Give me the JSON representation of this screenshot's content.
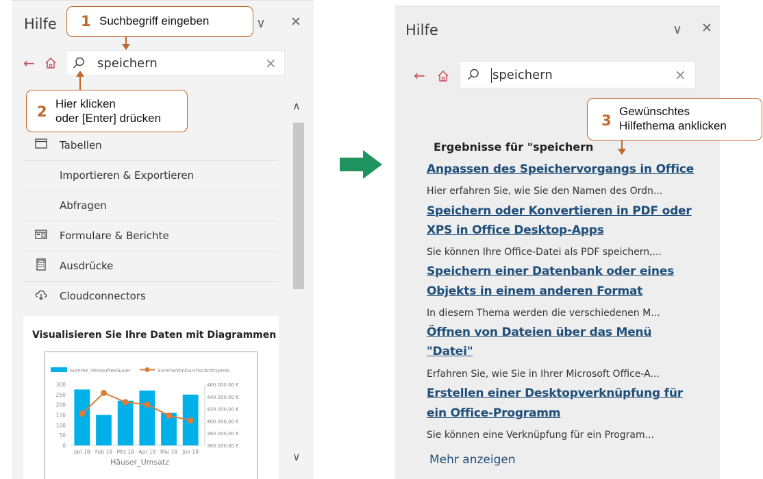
{
  "left_panel": {
    "title": "Hilfe",
    "search_value": "speichern",
    "categories": [
      {
        "label": "Tabellen",
        "icon": "table-icon"
      },
      {
        "label": "Importieren & Exportieren",
        "icon": ""
      },
      {
        "label": "Abfragen",
        "icon": ""
      },
      {
        "label": "Formulare & Berichte",
        "icon": "form-icon"
      },
      {
        "label": "Ausdrücke",
        "icon": "calculator-icon"
      },
      {
        "label": "Cloudconnectors",
        "icon": "cloud-icon"
      }
    ],
    "card": {
      "title": "Visualisieren Sie Ihre Daten mit Diagrammen"
    }
  },
  "chart_data": {
    "type": "bar",
    "title": "",
    "xlabel": "Häuser_Umsatz",
    "categories": [
      "Jan 18",
      "Feb 18",
      "Mrz 18",
      "Apr 18",
      "Mai 18",
      "Jun 18"
    ],
    "series": [
      {
        "name": "Summe_VerkaufteHäuser",
        "type": "bar",
        "axis": "left",
        "values": [
          275,
          150,
          220,
          270,
          160,
          250
        ]
      },
      {
        "name": "SummeVonDurchschnittspreis",
        "type": "line",
        "axis": "right",
        "values": [
          412000,
          446000,
          431000,
          427000,
          409000,
          401000
        ]
      }
    ],
    "y_left": {
      "ylim": [
        0,
        300
      ],
      "ticks": [
        "0",
        "50",
        "100",
        "150",
        "200",
        "250",
        "300"
      ]
    },
    "y_right": {
      "ylim": [
        360000,
        460000
      ],
      "ticks": [
        "360.000,00 €",
        "380.000,00 €",
        "400.000,00 €",
        "420.000,00 €",
        "440.000,00 €",
        "460.000,00 €"
      ]
    },
    "colors": {
      "bar": "#00b0e8",
      "line": "#e07b39"
    }
  },
  "right_panel": {
    "title": "Hilfe",
    "search_value": "speichern",
    "results_heading": "Ergebnisse für \"speichern",
    "results": [
      {
        "link_lines": [
          "Anpassen des Speichervorgangs in Office"
        ],
        "desc": "Hier erfahren Sie, wie Sie den Namen des Ordn..."
      },
      {
        "link_lines": [
          "Speichern oder Konvertieren in PDF oder",
          "XPS in Office Desktop-Apps"
        ],
        "desc": "Sie können Ihre Office-Datei als PDF speichern,..."
      },
      {
        "link_lines": [
          "Speichern einer Datenbank oder eines",
          "Objekts in einem anderen Format"
        ],
        "desc": "In diesem Thema werden die verschiedenen M..."
      },
      {
        "link_lines": [
          "Öffnen von Dateien über das Menü",
          "\"Datei\""
        ],
        "desc": "Erfahren Sie, wie Sie in Ihrer Microsoft Office-A..."
      },
      {
        "link_lines": [
          "Erstellen einer Desktopverknüpfung für",
          "ein Office-Programm"
        ],
        "desc": "Sie können eine Verknüpfung für ein Program..."
      }
    ],
    "more": "Mehr anzeigen"
  },
  "callouts": [
    {
      "num": "1",
      "lines": [
        "Suchbegriff eingeben"
      ]
    },
    {
      "num": "2",
      "lines": [
        "Hier klicken",
        "oder [Enter] drücken"
      ]
    },
    {
      "num": "3",
      "lines": [
        "Gewünschtes",
        "Hilfethema anklicken"
      ]
    }
  ],
  "colors": {
    "accent": "#c0672a",
    "link": "#1f4e79",
    "nav": "#c94c5a",
    "transition_arrow": "#1f9460"
  }
}
